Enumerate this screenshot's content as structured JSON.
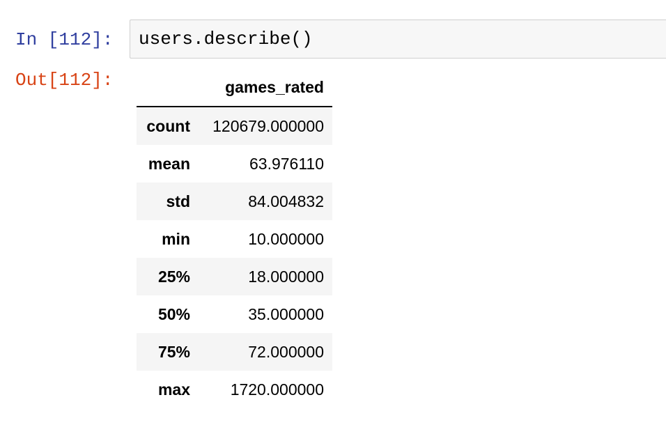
{
  "input_prompt": "In [112]:",
  "output_prompt": "Out[112]:",
  "code": "users.describe()",
  "table": {
    "index_header": "",
    "columns": [
      "games_rated"
    ],
    "rows": [
      {
        "label": "count",
        "value": "120679.000000"
      },
      {
        "label": "mean",
        "value": "63.976110"
      },
      {
        "label": "std",
        "value": "84.004832"
      },
      {
        "label": "min",
        "value": "10.000000"
      },
      {
        "label": "25%",
        "value": "18.000000"
      },
      {
        "label": "50%",
        "value": "35.000000"
      },
      {
        "label": "75%",
        "value": "72.000000"
      },
      {
        "label": "max",
        "value": "1720.000000"
      }
    ]
  },
  "colors": {
    "input_prompt": "#303F9F",
    "output_prompt": "#D84315",
    "code_cell_background": "#f7f7f7",
    "code_cell_border": "#cfcfcf",
    "striped_row": "#f5f5f5"
  }
}
